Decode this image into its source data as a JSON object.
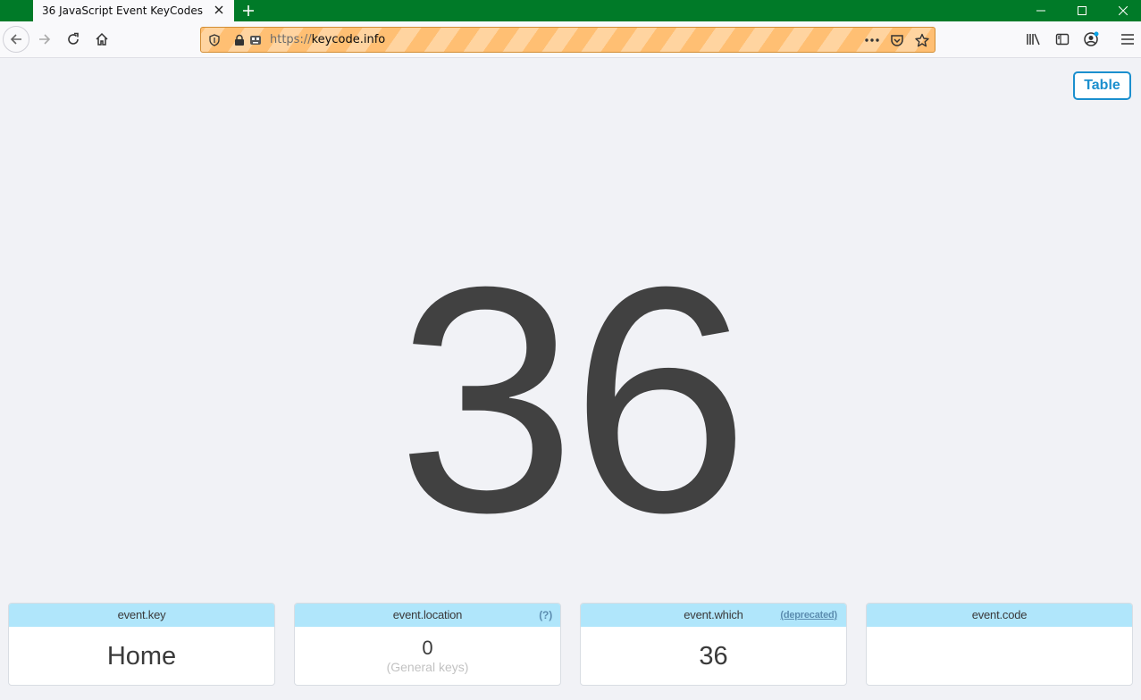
{
  "browser": {
    "tab_title": "36  JavaScript Event KeyCodes",
    "url_protocol": "https://",
    "url_host": "keycode.info",
    "icons": [
      "back-arrow-icon",
      "forward-arrow-icon",
      "reload-icon",
      "home-icon",
      "shield-icon",
      "lock-icon",
      "robot-icon",
      "more-icon",
      "pocket-icon",
      "star-icon",
      "library-icon",
      "sidebar-icon",
      "account-icon",
      "menu-icon"
    ],
    "titlebar_color": "#007a28"
  },
  "page": {
    "table_button": "Table",
    "keycode": "36",
    "cards": [
      {
        "title": "event.key",
        "value": "Home"
      },
      {
        "title": "event.location",
        "extra": "(?)",
        "value": "0",
        "sub": "(General keys)"
      },
      {
        "title": "event.which",
        "extra": "(deprecated)",
        "value": "36"
      },
      {
        "title": "event.code",
        "value": ""
      }
    ]
  }
}
